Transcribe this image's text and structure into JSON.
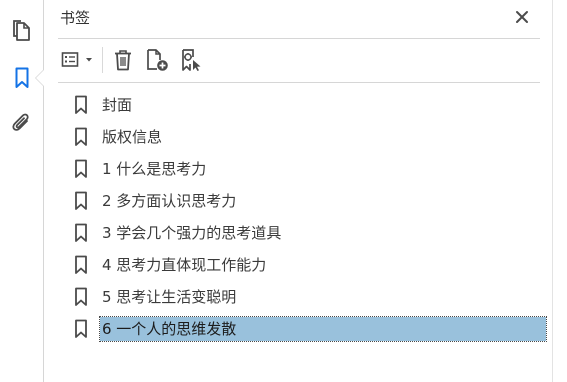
{
  "panel": {
    "title": "书签"
  },
  "rail": {
    "items": [
      {
        "name": "pages-icon"
      },
      {
        "name": "bookmark-icon",
        "active": true
      },
      {
        "name": "attachment-icon"
      }
    ]
  },
  "toolbar": {
    "items": [
      "options-menu",
      "delete",
      "new-bookmark",
      "new-bookmark-from-structure"
    ]
  },
  "bookmarks": [
    {
      "label": "封面"
    },
    {
      "label": "版权信息"
    },
    {
      "label": "1 什么是思考力"
    },
    {
      "label": "2 多方面认识思考力"
    },
    {
      "label": "3 学会几个强力的思考道具"
    },
    {
      "label": "4 思考力直体现工作能力"
    },
    {
      "label": "5 思考让生活变聪明"
    },
    {
      "label": "6 一个人的思维发散",
      "selected": true
    }
  ],
  "colors": {
    "accent": "#1473e6",
    "selection": "#99c1dc",
    "icon": "#4b4b4b"
  }
}
